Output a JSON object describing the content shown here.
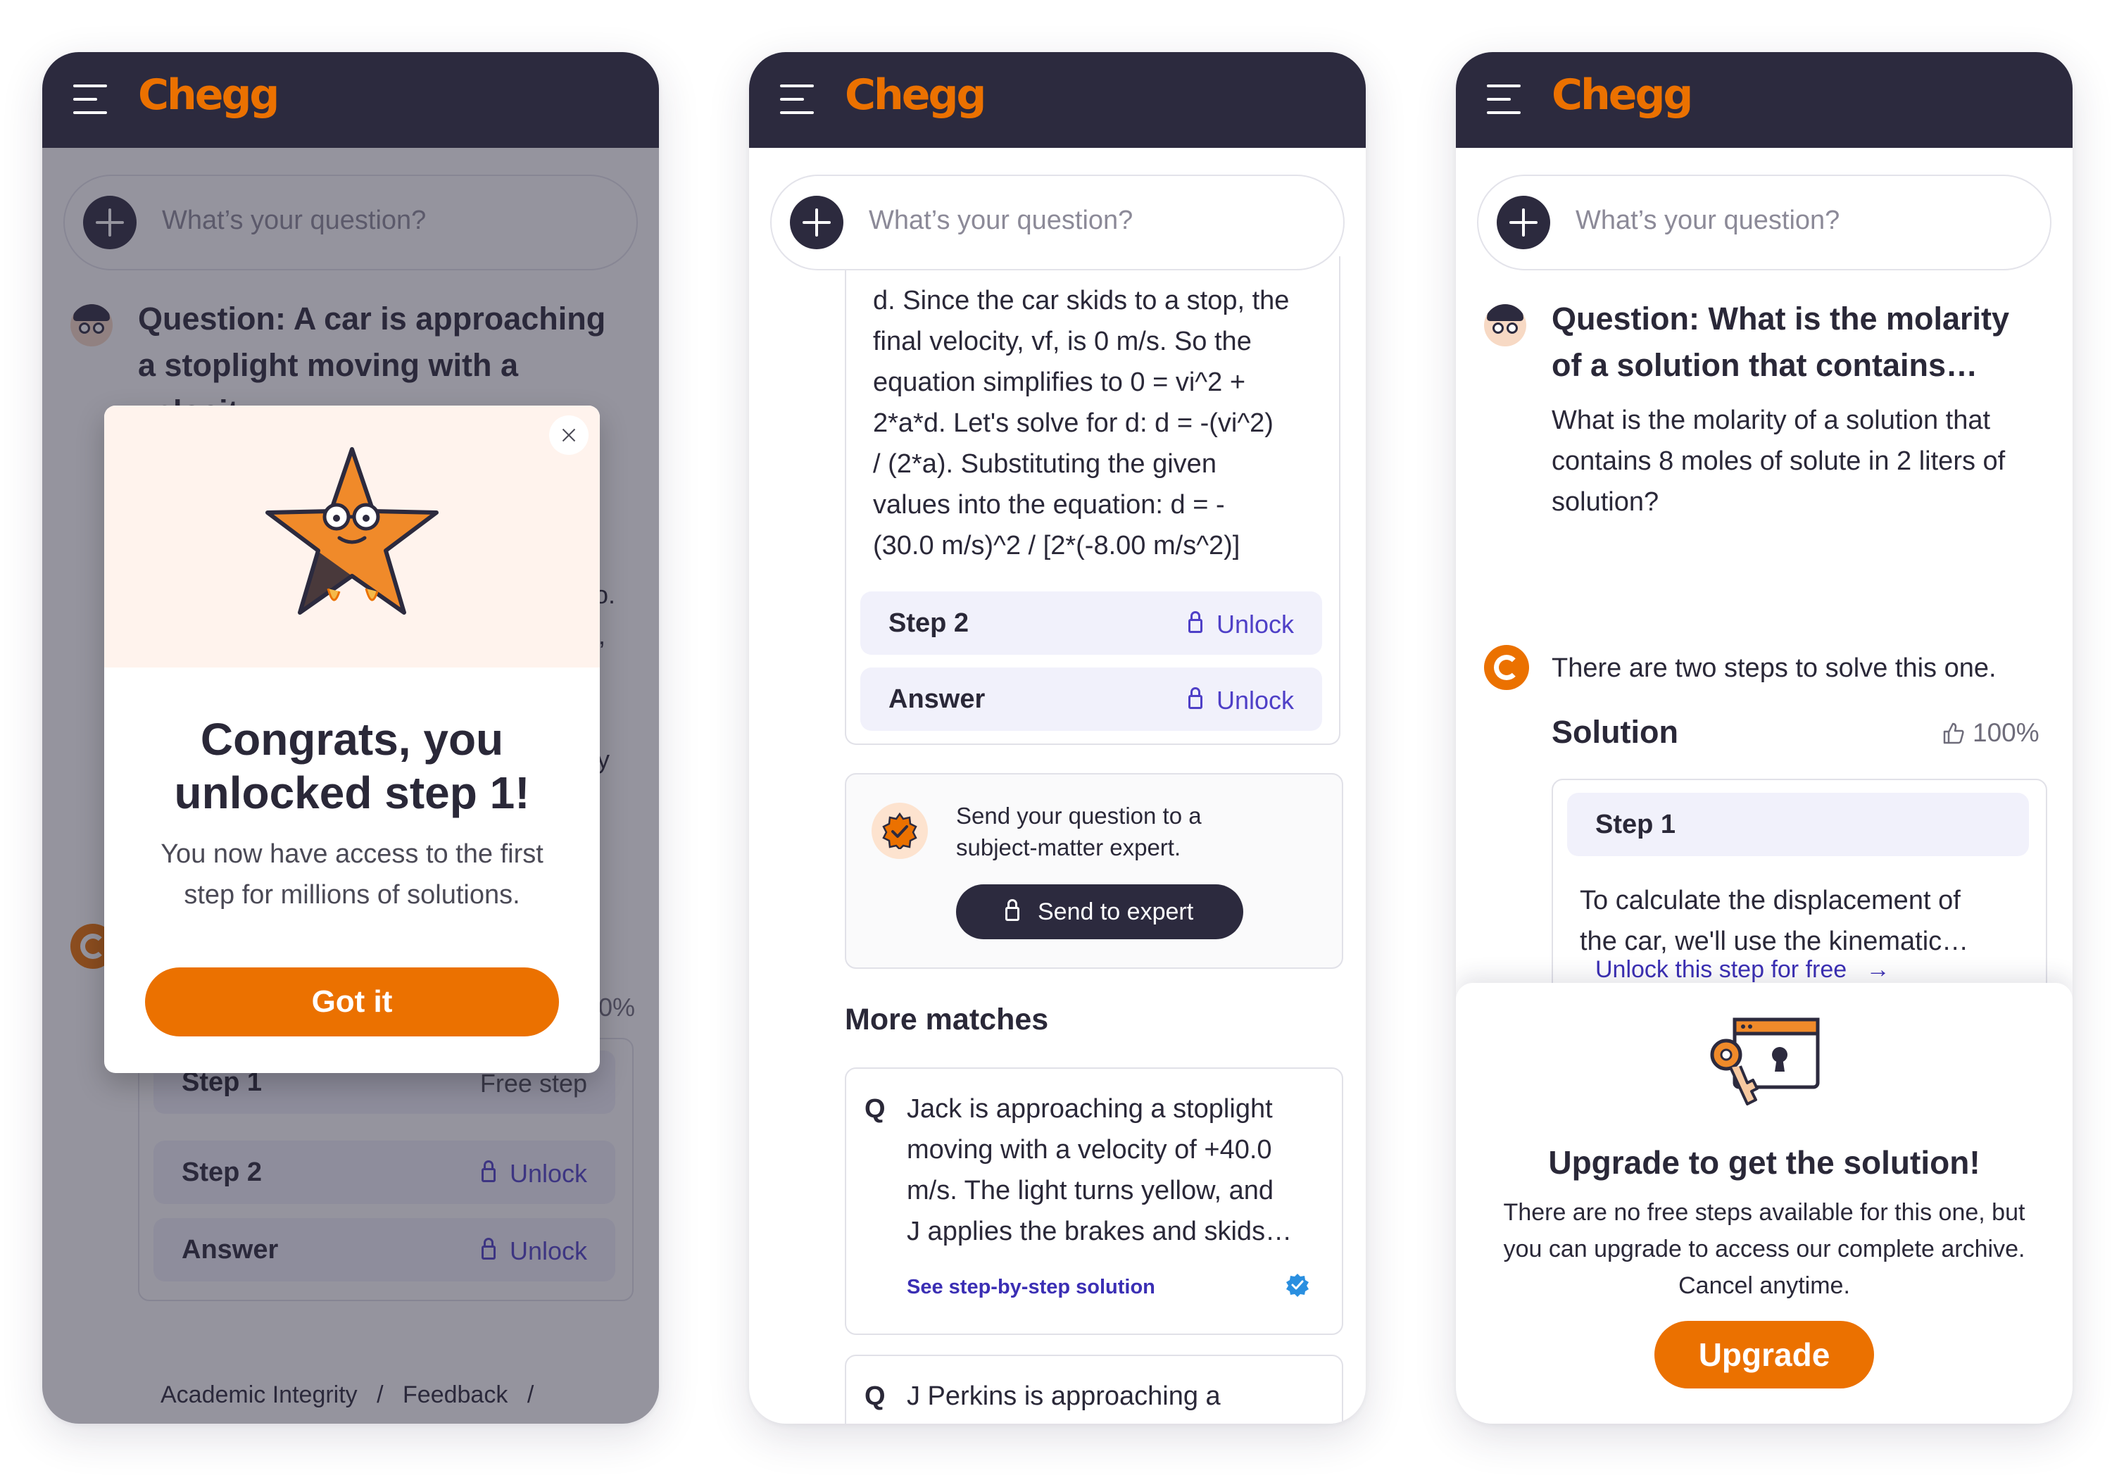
{
  "brand": {
    "logo_text": "Chegg",
    "accent": "#eb7100",
    "header_bg": "#2c2a3e",
    "link_color": "#3b2fb4"
  },
  "search": {
    "placeholder": "What’s your question?"
  },
  "screen1": {
    "question_title_line1": "Question: A car is approaching",
    "question_title_line2": "a stoplight moving with a",
    "question_title_line3": "velocity",
    "peek": {
      "a": "o.",
      "b": ",",
      "c": "y",
      "d": "0%"
    },
    "steps": [
      {
        "label": "Step 1",
        "status": "Free step"
      },
      {
        "label": "Step 2",
        "status": "Unlock"
      },
      {
        "label": "Answer",
        "status": "Unlock"
      }
    ],
    "modal": {
      "title_line1": "Congrats, you",
      "title_line2": "unlocked step 1!",
      "text_line1": "You now have access to the first",
      "text_line2": "step for millions of solutions.",
      "button": "Got it"
    },
    "footer": {
      "link1": "Academic Integrity",
      "sep1": "/",
      "link2": "Feedback",
      "sep2": "/"
    }
  },
  "screen2": {
    "solution_lines": [
      "d. Since the car skids to a stop, the",
      "final velocity, vf, is 0 m/s. So the",
      "equation simplifies to 0 = vi^2 +",
      "2*a*d. Let's solve for d: d = -(vi^2)",
      "/ (2*a). Substituting the given",
      "values into the equation: d = -",
      "(30.0 m/s)^2 / [2*(-8.00 m/s^2)]"
    ],
    "steps": [
      {
        "label": "Step 2",
        "status": "Unlock"
      },
      {
        "label": "Answer",
        "status": "Unlock"
      }
    ],
    "expert": {
      "text_line1": "Send your question to a",
      "text_line2": "subject-matter expert.",
      "button": "Send to expert"
    },
    "more_matches_heading": "More matches",
    "matches": [
      {
        "q": "Q",
        "lines": [
          "Jack is approaching a stoplight",
          "moving with a velocity of +40.0",
          "m/s. The light turns yellow, and",
          "J applies the brakes and skids…"
        ],
        "link": "See step-by-step solution"
      },
      {
        "q": "Q",
        "lines": [
          "J Perkins is approaching a"
        ]
      }
    ]
  },
  "screen3": {
    "question_title_line1": "Question: What is the molarity",
    "question_title_line2": "of a solution that contains…",
    "question_body": [
      "What is the molarity of a solution that",
      "contains 8 moles of solute in 2 liters of",
      "solution?"
    ],
    "steps_intro": "There are two steps to solve this one.",
    "solution_heading": "Solution",
    "rating": "100%",
    "step1": {
      "label": "Step 1",
      "lines": [
        "To calculate the displacement of",
        "the car, we'll use the kinematic…"
      ],
      "unlock_link": "Unlock this step for free",
      "arrow": "→"
    },
    "upgrade": {
      "title": "Upgrade to get the solution!",
      "text_lines": [
        "There are no free steps available for this one, but",
        "you can upgrade to access our complete archive.",
        "Cancel anytime."
      ],
      "button": "Upgrade"
    }
  }
}
